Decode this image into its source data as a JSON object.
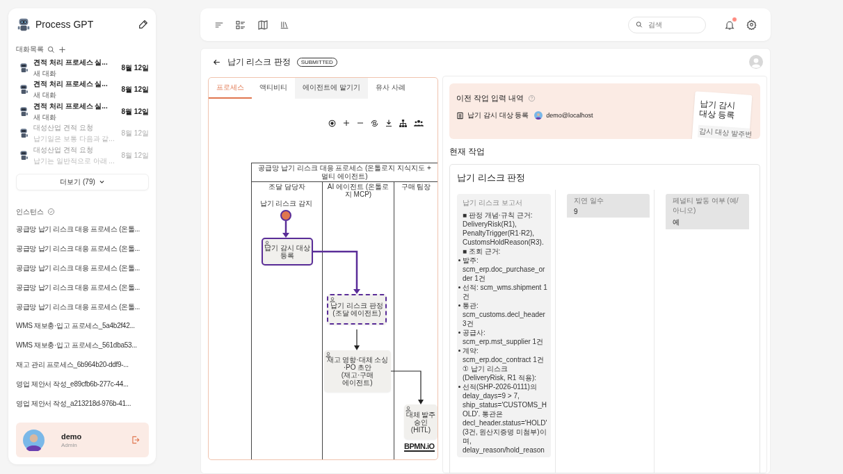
{
  "app": {
    "name": "Process GPT"
  },
  "sidebar": {
    "chats_heading": "대화목록",
    "chats": [
      {
        "title": "견적 처리 프로세스 실...",
        "preview": "새 대화",
        "date": "8월 12일",
        "unread": true
      },
      {
        "title": "견적 처리 프로세스 실...",
        "preview": "새 대화",
        "date": "8월 12일",
        "unread": true
      },
      {
        "title": "견적 처리 프로세스 실...",
        "preview": "새 대화",
        "date": "8월 12일",
        "unread": true
      },
      {
        "title": "대성산업 견적 요청",
        "preview": "납기일은 보통 다음과 같...",
        "date": "8월 12일",
        "unread": false
      },
      {
        "title": "대성산업 견적 요청",
        "preview": "납기는 일반적으로 아래 ...",
        "date": "8월 12일",
        "unread": false
      }
    ],
    "more_button": "더보기 (79)",
    "instances_heading": "인스턴스",
    "instances": [
      "공급망 납기 리스크 대응 프로세스 (온톨...",
      "공급망 납기 리스크 대응 프로세스 (온톨...",
      "공급망 납기 리스크 대응 프로세스 (온톨...",
      "공급망 납기 리스크 대응 프로세스 (온톨...",
      "공급망 납기 리스크 대응 프로세스 (온톨...",
      "WMS 재보충·입고 프로세스_5a4b2f42...",
      "WMS 재보충·입고 프로세스_561dba53...",
      "재고 관리 프로세스_6b964b20-ddf9-...",
      "영업 제안서 작성_e89cfb6b-277c-44...",
      "영업 제안서 작성_a213218d-976b-41..."
    ],
    "user": {
      "name": "demo",
      "role": "Admin"
    }
  },
  "topbar": {
    "search": {
      "placeholder": "검색"
    },
    "has_notifications": true
  },
  "task": {
    "title": "납기 리스크 판정",
    "status": "SUBMITTED",
    "tabs": [
      {
        "label": "프로세스",
        "selected": true,
        "hovered": false
      },
      {
        "label": "액티비티",
        "selected": false,
        "hovered": false
      },
      {
        "label": "에이전트에 맡기기",
        "selected": false,
        "hovered": true
      },
      {
        "label": "유사 사례",
        "selected": false,
        "hovered": false
      }
    ],
    "diagram": {
      "title": "공급망 납기 리스크 대응 프로세스 (온톨로지 지식지도 + 멀티 에이전트)",
      "lanes": [
        "조달 담당자",
        "AI 에이전트 (온톨로지 MCP)",
        "구매 팀장"
      ],
      "start": {
        "label": "납기 리스크 감지",
        "completed": true
      },
      "tasks": [
        {
          "label": "납기 감시 대상 등록",
          "completed": true,
          "running": false
        },
        {
          "label": "납기 리스크 판정",
          "sublabel": "(조달 에이전트)",
          "completed": false,
          "running": true
        },
        {
          "label": "재고 영향·대체 소싱·PO 초안",
          "sublabel": "(재고·구매 에이전트)",
          "completed": false,
          "running": false
        },
        {
          "label": "대체 발주 승인",
          "sublabel": "(HITL)",
          "completed": false,
          "running": false
        }
      ],
      "edges": [
        {
          "traversed": true
        },
        {
          "traversed": true
        },
        {
          "traversed": false
        },
        {
          "traversed": false
        }
      ],
      "logo": "BPMN.iO"
    },
    "previous": {
      "heading": "이전 작업 입력 내역",
      "activity": "납기 감시 대상 등록",
      "user": "demo@localhost",
      "preview": {
        "title": "납기 감시 대상 등록",
        "field": "감시 대상 발주번"
      }
    },
    "current": {
      "heading": "현재 작업",
      "form_title": "납기 리스크 판정",
      "fields": [
        {
          "kind": "report",
          "label": "납기 리스크 보고서",
          "lines": [
            {
              "kind": "text",
              "text": "■ 판정 개념·규칙 근거: DeliveryRisk(R1), PenaltyTrigger(R1·R2), CustomsHoldReason(R3)."
            },
            {
              "kind": "text",
              "text": "■ 조회 근거:"
            },
            {
              "kind": "bullet",
              "text": "발주: scm_erp.doc_purchase_order 1건"
            },
            {
              "kind": "bullet",
              "text": "선적: scm_wms.shipment 1건"
            },
            {
              "kind": "bullet",
              "text": "통관: scm_customs.decl_header 3건"
            },
            {
              "kind": "bullet",
              "text": "공급사: scm_erp.mst_supplier 1건"
            },
            {
              "kind": "bullet",
              "text": "계약: scm_erp.doc_contract 1건"
            },
            {
              "kind": "text",
              "text": "① 납기 리스크(DeliveryRisk, R1 적용):"
            },
            {
              "kind": "bullet",
              "text": "선적(SHP-2026-0111)의 delay_days=9 > 7, ship_status='CUSTOMS_HOLD'. 통관은 decl_header.status='HOLD'(3건, 원산지증명 미첨부)이며, delay_reason/hold_reason"
            }
          ]
        },
        {
          "kind": "input",
          "label": "지연 일수",
          "value": "9"
        },
        {
          "kind": "input",
          "label": "페널티 발동 여부 (예/아니오)",
          "value": "예"
        }
      ]
    }
  }
}
